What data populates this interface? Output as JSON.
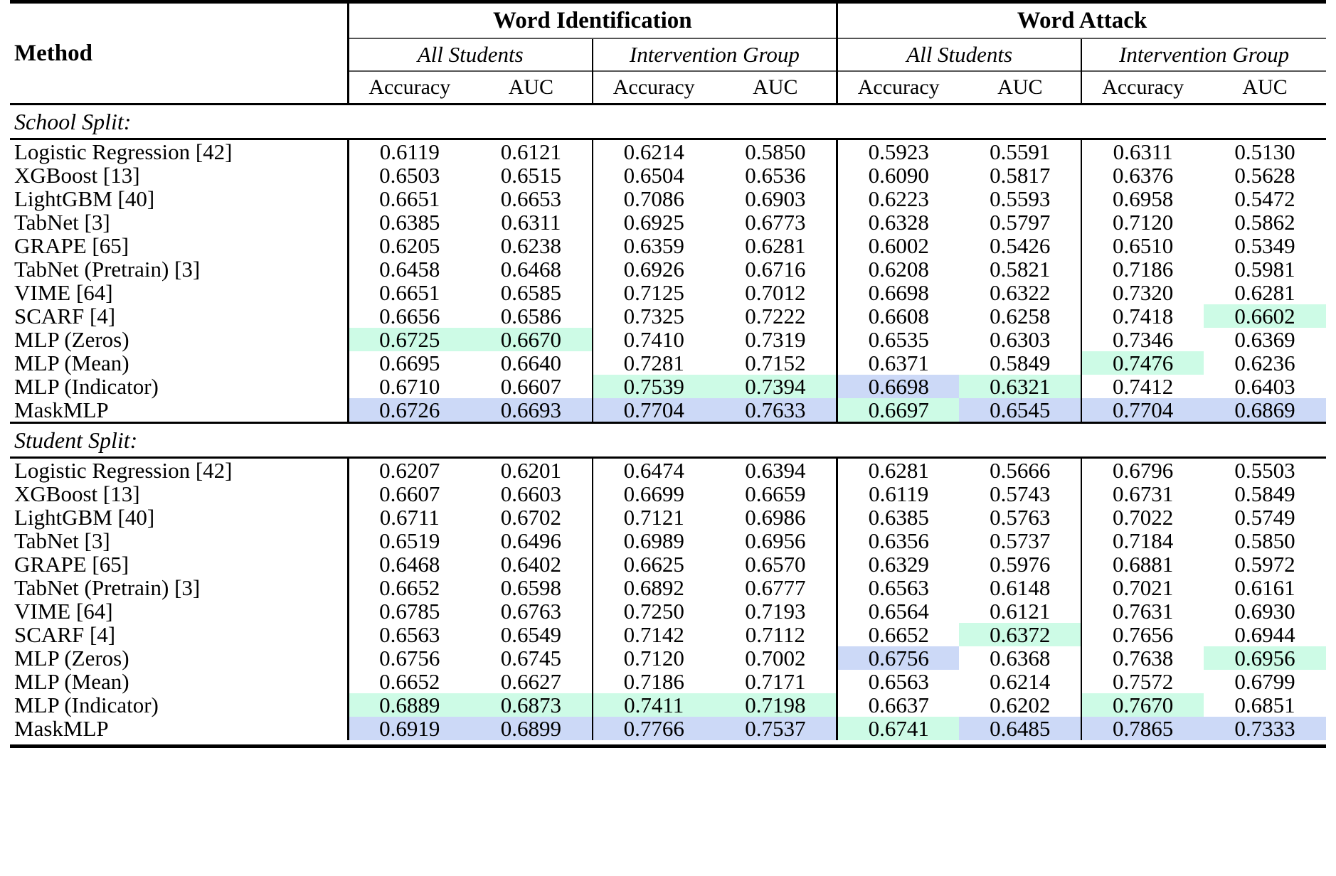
{
  "table": {
    "colors": {
      "highlight_green": "#cdfbe6",
      "highlight_blue": "#ccd9f7",
      "rule": "#000000"
    },
    "header": {
      "method_label": "Method",
      "groups": [
        {
          "label": "Word Identification"
        },
        {
          "label": "Word Attack"
        }
      ],
      "subgroups": [
        "All Students",
        "Intervention Group",
        "All Students",
        "Intervention Group"
      ],
      "metrics": [
        "Accuracy",
        "AUC",
        "Accuracy",
        "AUC",
        "Accuracy",
        "AUC",
        "Accuracy",
        "AUC"
      ]
    },
    "sections": [
      {
        "label": "School Split:",
        "rows": [
          {
            "method": "Logistic Regression [42]",
            "values": [
              "0.6119",
              "0.6121",
              "0.6214",
              "0.5850",
              "0.5923",
              "0.5591",
              "0.6311",
              "0.5130"
            ],
            "hl": [
              "",
              "",
              "",
              "",
              "",
              "",
              "",
              ""
            ]
          },
          {
            "method": "XGBoost [13]",
            "values": [
              "0.6503",
              "0.6515",
              "0.6504",
              "0.6536",
              "0.6090",
              "0.5817",
              "0.6376",
              "0.5628"
            ],
            "hl": [
              "",
              "",
              "",
              "",
              "",
              "",
              "",
              ""
            ]
          },
          {
            "method": "LightGBM [40]",
            "values": [
              "0.6651",
              "0.6653",
              "0.7086",
              "0.6903",
              "0.6223",
              "0.5593",
              "0.6958",
              "0.5472"
            ],
            "hl": [
              "",
              "",
              "",
              "",
              "",
              "",
              "",
              ""
            ]
          },
          {
            "method": "TabNet [3]",
            "values": [
              "0.6385",
              "0.6311",
              "0.6925",
              "0.6773",
              "0.6328",
              "0.5797",
              "0.7120",
              "0.5862"
            ],
            "hl": [
              "",
              "",
              "",
              "",
              "",
              "",
              "",
              ""
            ]
          },
          {
            "method": "GRAPE [65]",
            "values": [
              "0.6205",
              "0.6238",
              "0.6359",
              "0.6281",
              "0.6002",
              "0.5426",
              "0.6510",
              "0.5349"
            ],
            "hl": [
              "",
              "",
              "",
              "",
              "",
              "",
              "",
              ""
            ]
          },
          {
            "method": "TabNet (Pretrain) [3]",
            "values": [
              "0.6458",
              "0.6468",
              "0.6926",
              "0.6716",
              "0.6208",
              "0.5821",
              "0.7186",
              "0.5981"
            ],
            "hl": [
              "",
              "",
              "",
              "",
              "",
              "",
              "",
              ""
            ]
          },
          {
            "method": "VIME [64]",
            "values": [
              "0.6651",
              "0.6585",
              "0.7125",
              "0.7012",
              "0.6698",
              "0.6322",
              "0.7320",
              "0.6281"
            ],
            "hl": [
              "",
              "",
              "",
              "",
              "",
              "",
              "",
              ""
            ]
          },
          {
            "method": "SCARF [4]",
            "values": [
              "0.6656",
              "0.6586",
              "0.7325",
              "0.7222",
              "0.6608",
              "0.6258",
              "0.7418",
              "0.6602"
            ],
            "hl": [
              "",
              "",
              "",
              "",
              "",
              "",
              "",
              "green"
            ]
          },
          {
            "method": "MLP (Zeros)",
            "values": [
              "0.6725",
              "0.6670",
              "0.7410",
              "0.7319",
              "0.6535",
              "0.6303",
              "0.7346",
              "0.6369"
            ],
            "hl": [
              "green",
              "green",
              "",
              "",
              "",
              "",
              "",
              ""
            ]
          },
          {
            "method": "MLP (Mean)",
            "values": [
              "0.6695",
              "0.6640",
              "0.7281",
              "0.7152",
              "0.6371",
              "0.5849",
              "0.7476",
              "0.6236"
            ],
            "hl": [
              "",
              "",
              "",
              "",
              "",
              "",
              "green",
              ""
            ]
          },
          {
            "method": "MLP (Indicator)",
            "values": [
              "0.6710",
              "0.6607",
              "0.7539",
              "0.7394",
              "0.6698",
              "0.6321",
              "0.7412",
              "0.6403"
            ],
            "hl": [
              "",
              "",
              "green",
              "green",
              "blue",
              "green",
              "",
              ""
            ]
          },
          {
            "method": "MaskMLP",
            "values": [
              "0.6726",
              "0.6693",
              "0.7704",
              "0.7633",
              "0.6697",
              "0.6545",
              "0.7704",
              "0.6869"
            ],
            "hl": [
              "blue",
              "blue",
              "blue",
              "blue",
              "green",
              "blue",
              "blue",
              "blue"
            ]
          }
        ]
      },
      {
        "label": "Student Split:",
        "rows": [
          {
            "method": "Logistic Regression [42]",
            "values": [
              "0.6207",
              "0.6201",
              "0.6474",
              "0.6394",
              "0.6281",
              "0.5666",
              "0.6796",
              "0.5503"
            ],
            "hl": [
              "",
              "",
              "",
              "",
              "",
              "",
              "",
              ""
            ]
          },
          {
            "method": "XGBoost [13]",
            "values": [
              "0.6607",
              "0.6603",
              "0.6699",
              "0.6659",
              "0.6119",
              "0.5743",
              "0.6731",
              "0.5849"
            ],
            "hl": [
              "",
              "",
              "",
              "",
              "",
              "",
              "",
              ""
            ]
          },
          {
            "method": "LightGBM [40]",
            "values": [
              "0.6711",
              "0.6702",
              "0.7121",
              "0.6986",
              "0.6385",
              "0.5763",
              "0.7022",
              "0.5749"
            ],
            "hl": [
              "",
              "",
              "",
              "",
              "",
              "",
              "",
              ""
            ]
          },
          {
            "method": "TabNet [3]",
            "values": [
              "0.6519",
              "0.6496",
              "0.6989",
              "0.6956",
              "0.6356",
              "0.5737",
              "0.7184",
              "0.5850"
            ],
            "hl": [
              "",
              "",
              "",
              "",
              "",
              "",
              "",
              ""
            ]
          },
          {
            "method": "GRAPE [65]",
            "values": [
              "0.6468",
              "0.6402",
              "0.6625",
              "0.6570",
              "0.6329",
              "0.5976",
              "0.6881",
              "0.5972"
            ],
            "hl": [
              "",
              "",
              "",
              "",
              "",
              "",
              "",
              ""
            ]
          },
          {
            "method": "TabNet (Pretrain) [3]",
            "values": [
              "0.6652",
              "0.6598",
              "0.6892",
              "0.6777",
              "0.6563",
              "0.6148",
              "0.7021",
              "0.6161"
            ],
            "hl": [
              "",
              "",
              "",
              "",
              "",
              "",
              "",
              ""
            ]
          },
          {
            "method": "VIME [64]",
            "values": [
              "0.6785",
              "0.6763",
              "0.7250",
              "0.7193",
              "0.6564",
              "0.6121",
              "0.7631",
              "0.6930"
            ],
            "hl": [
              "",
              "",
              "",
              "",
              "",
              "",
              "",
              ""
            ]
          },
          {
            "method": "SCARF [4]",
            "values": [
              "0.6563",
              "0.6549",
              "0.7142",
              "0.7112",
              "0.6652",
              "0.6372",
              "0.7656",
              "0.6944"
            ],
            "hl": [
              "",
              "",
              "",
              "",
              "",
              "green",
              "",
              ""
            ]
          },
          {
            "method": "MLP (Zeros)",
            "values": [
              "0.6756",
              "0.6745",
              "0.7120",
              "0.7002",
              "0.6756",
              "0.6368",
              "0.7638",
              "0.6956"
            ],
            "hl": [
              "",
              "",
              "",
              "",
              "blue",
              "",
              "",
              "green"
            ]
          },
          {
            "method": "MLP (Mean)",
            "values": [
              "0.6652",
              "0.6627",
              "0.7186",
              "0.7171",
              "0.6563",
              "0.6214",
              "0.7572",
              "0.6799"
            ],
            "hl": [
              "",
              "",
              "",
              "",
              "",
              "",
              "",
              ""
            ]
          },
          {
            "method": "MLP (Indicator)",
            "values": [
              "0.6889",
              "0.6873",
              "0.7411",
              "0.7198",
              "0.6637",
              "0.6202",
              "0.7670",
              "0.6851"
            ],
            "hl": [
              "green",
              "green",
              "green",
              "green",
              "",
              "",
              "green",
              ""
            ]
          },
          {
            "method": "MaskMLP",
            "values": [
              "0.6919",
              "0.6899",
              "0.7766",
              "0.7537",
              "0.6741",
              "0.6485",
              "0.7865",
              "0.7333"
            ],
            "hl": [
              "blue",
              "blue",
              "blue",
              "blue",
              "green",
              "blue",
              "blue",
              "blue"
            ]
          }
        ]
      }
    ]
  }
}
